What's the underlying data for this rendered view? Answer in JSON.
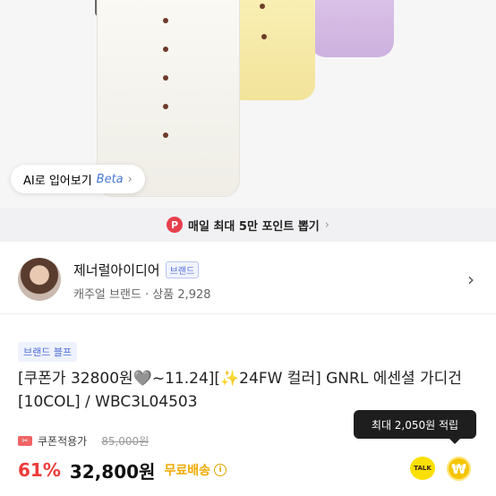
{
  "try_on": {
    "label": "AI로 입어보기",
    "beta": "Beta",
    "chevron": "›"
  },
  "promo": {
    "icon": "P",
    "text": "매일 최대 5만 포인트 뽑기",
    "chevron": "›"
  },
  "seller": {
    "name": "제너럴아이디어",
    "tag": "브랜드",
    "subtitle": "캐주얼 브랜드 · 상품 2,928",
    "chevron": "›"
  },
  "product": {
    "badge": "브랜드 블프",
    "title": "[쿠폰가 32800원🩶~11.24][✨24FW 컬러] GNRL 에센셜 가디건 [10COL] / WBC3L04503",
    "coupon_icon_text": "✂",
    "coupon_label": "쿠폰적용가",
    "original_price": "85,000원",
    "discount": "61%",
    "price": "32,800원",
    "shipping": "무료배송",
    "info_icon": "i"
  },
  "tooltip": {
    "text": "최대 2,050원 적립"
  },
  "floating": {
    "talk_label": "TALK",
    "won_symbol": "₩"
  },
  "colors": {
    "accent_red": "#ec3b3b",
    "shipping_yellow": "#f0a900",
    "brand_blue": "#4f6fd6"
  }
}
